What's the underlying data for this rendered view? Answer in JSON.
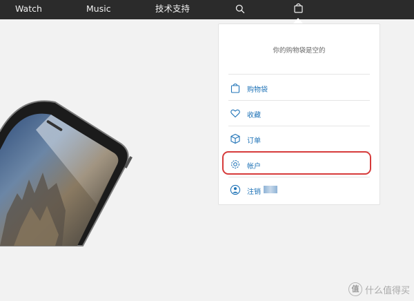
{
  "nav": {
    "watch": "Watch",
    "music": "Music",
    "support": "技术支持",
    "search_icon": "search-icon",
    "bag_icon": "shopping-bag-icon"
  },
  "bag_menu": {
    "empty_message": "你的购物袋是空的",
    "items": [
      {
        "label": "购物袋",
        "icon": "bag-icon"
      },
      {
        "label": "收藏",
        "icon": "heart-icon"
      },
      {
        "label": "订单",
        "icon": "box-icon"
      },
      {
        "label": "帐户",
        "icon": "gear-icon"
      },
      {
        "label": "注销",
        "icon": "user-icon"
      }
    ]
  },
  "watermark": {
    "badge": "值",
    "text": "什么值得买"
  },
  "colors": {
    "nav_bg": "#2b2b2b",
    "link": "#1f73b7",
    "highlight": "#d63a3a",
    "page_bg": "#f2f2f2"
  }
}
